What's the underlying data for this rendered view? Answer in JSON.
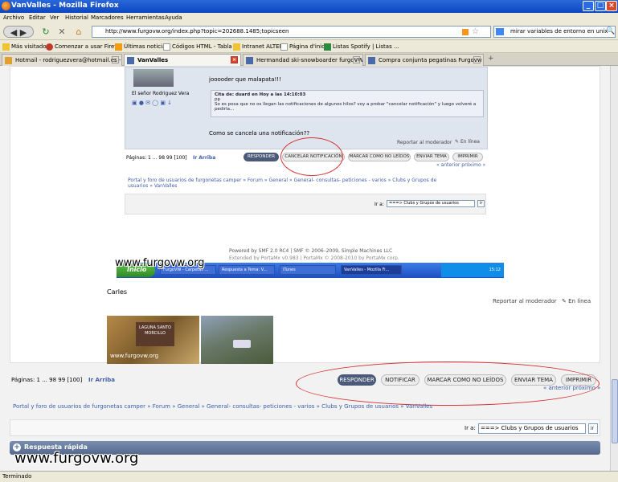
{
  "window": {
    "title": "VanValles - Mozilla Firefox",
    "min": "_",
    "max": "□",
    "close": "×"
  },
  "menu": [
    "Archivo",
    "Editar",
    "Ver",
    "Historial",
    "Marcadores",
    "Herramientas",
    "Ayuda"
  ],
  "nav": {
    "url": "http://www.furgovw.org/index.php?topic=202688.1485;topicseen",
    "search": "mirar variables de entorno en unix"
  },
  "bookmarks": [
    "Más visitados",
    "Comenzar a usar Firef...",
    "Últimas noticias",
    "Códigos HTML - Tabla ...",
    "Intranet ALTEN",
    "Página d'inici",
    "Listas Spotify | Listas ..."
  ],
  "tabs": [
    "Hotmail - rodriguezvera@hotmail.es - ...",
    "VanValles",
    "Hermandad ski-snowboarder furgoVW: ...",
    "Compra conjunta pegatinas Furgovw"
  ],
  "status": "Terminado",
  "inner": {
    "post_text": "jooooder que malapata!!!",
    "author": "El señor Rodriguez Vera",
    "quote_head": "Cita de: duard en Hoy a las 14:10:03",
    "quote_body": "pp\nSo es posa que no os llegan las notificaciones de algunos hilos? voy a probar \"cancelar notificación\" y luego volveré a pedirla...",
    "question": "Como se cancela una notificación??",
    "report": "Reportar al moderador",
    "online": "En línea",
    "pages": "Páginas: 1 ... 98 99 [100]",
    "ir_arriba": "Ir Arriba",
    "buttons": [
      "RESPONDER",
      "CANCELAR NOTIFICACIÓN",
      "MARCAR COMO NO LEÍDOS",
      "ENVIAR TEMA",
      "IMPRIMIR"
    ],
    "prevnext": "« anterior próximo »",
    "breadcrumb": "Portal y foro de usuarios de furgonetas camper » Forum » General » General- consultas- peticiones - varios » Clubs y Grupos de usuarios » VanValles",
    "ir_a": "Ir a:",
    "ir_a_select": "===> Clubs y Grupos de usuarios",
    "go": "ir",
    "footer1": "Powered by SMF 2.0 RC4 | SMF © 2006–2009, Simple Machines LLC",
    "footer2": "Extended by PortaMx v0.983 | PortaMx © 2008-2010 by PortaMx corp."
  },
  "taskbar": {
    "start": "Inicio",
    "items": [
      "FurgoVW - Carpetas ...",
      "Respuesta a Tema: V...",
      "iTunes",
      "VanValles - Mozilla Fi..."
    ],
    "clock": "15:12"
  },
  "watermark": "www.furgovw.org",
  "post": {
    "author_sig": "Carles",
    "report": "Reportar al moderador",
    "online": "En línea",
    "photo_label": "LAGUNA SANTO MORCILLO"
  },
  "bottom": {
    "pages": "Páginas: 1 ... 98 99 [100]",
    "ir_arriba": "Ir Arriba",
    "buttons": [
      "RESPONDER",
      "NOTIFICAR",
      "MARCAR COMO NO LEÍDOS",
      "ENVIAR TEMA",
      "IMPRIMIR"
    ],
    "prevnext": "« anterior próximo »",
    "breadcrumb": "Portal y foro de usuarios de furgonetas camper » Forum » General » General- consultas- peticiones - varios » Clubs y Grupos de usuarios » VanValles",
    "ir_a": "Ir a:",
    "ir_a_select": "===> Clubs y Grupos de usuarios",
    "go": "ir",
    "quick_reply": "Respuesta rápida"
  }
}
